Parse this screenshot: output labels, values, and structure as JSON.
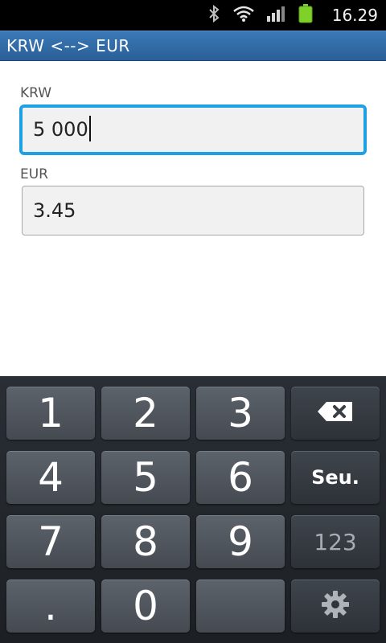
{
  "status_bar": {
    "time": "16.29",
    "icons": [
      "bluetooth-icon",
      "wifi-icon",
      "signal-icon",
      "battery-icon"
    ]
  },
  "app": {
    "title": "KRW <--> EUR"
  },
  "form": {
    "krw_label": "KRW",
    "krw_value": "5 000",
    "eur_label": "EUR",
    "eur_value": "3.45"
  },
  "keyboard": {
    "keys": {
      "k1": "1",
      "k2": "2",
      "k3": "3",
      "k4": "4",
      "k5": "5",
      "k6": "6",
      "k7": "7",
      "k8": "8",
      "k9": "9",
      "kdot": ".",
      "k0": "0",
      "next": "Seu.",
      "mode": "123"
    },
    "icons": {
      "backspace": "backspace-icon",
      "settings": "gear-icon"
    }
  },
  "colors": {
    "title_bar": "#2f6aa6",
    "focus_border": "#1ea0e4",
    "keyboard_bg": "#22262b",
    "battery": "#7fd12a"
  }
}
